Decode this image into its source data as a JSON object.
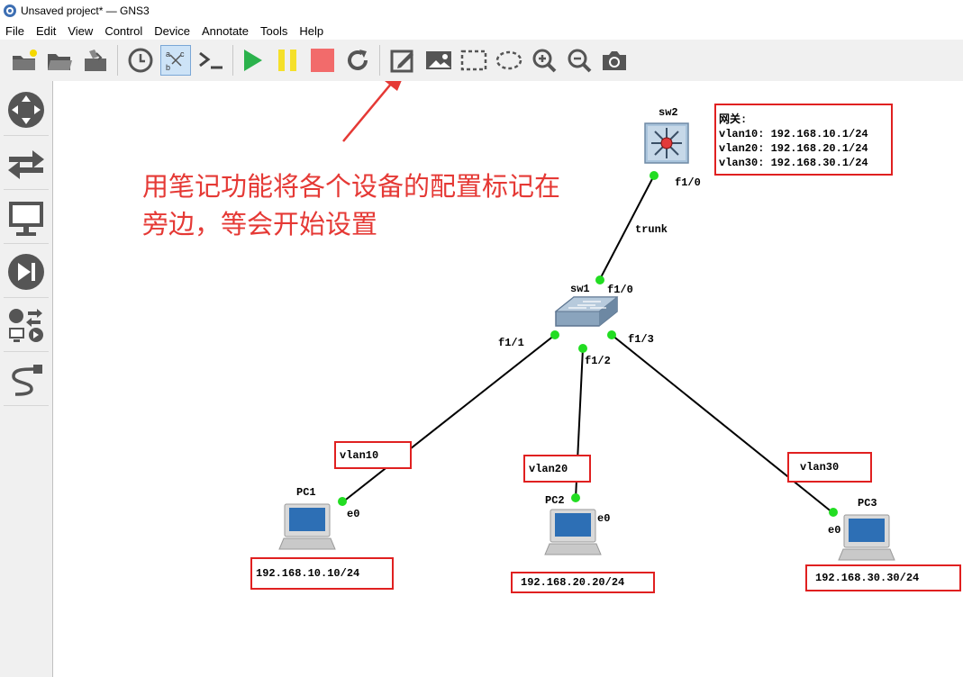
{
  "window": {
    "title": "Unsaved project* — GNS3"
  },
  "menu": [
    "File",
    "Edit",
    "View",
    "Control",
    "Device",
    "Annotate",
    "Tools",
    "Help"
  ],
  "toolbar": {
    "buttons": [
      "open-folder",
      "open-project",
      "snapshot",
      "clock",
      "show-interface-labels",
      "console",
      "start",
      "pause",
      "stop",
      "reload",
      "add-note",
      "insert-image",
      "draw-rectangle",
      "draw-ellipse",
      "zoom-in",
      "zoom-out",
      "screenshot"
    ]
  },
  "colors": {
    "annotation_red": "#e02020",
    "link_green": "#22dd22",
    "note_text": "#e53935"
  },
  "devices": {
    "sw2": "sw2",
    "sw1": "sw1",
    "pc1": "PC1",
    "pc2": "PC2",
    "pc3": "PC3"
  },
  "ports": {
    "sw2_f10": "f1/0",
    "sw1_f10": "f1/0",
    "sw1_f11": "f1/1",
    "sw1_f12": "f1/2",
    "sw1_f13": "f1/3",
    "pc1_e0": "e0",
    "pc2_e0": "e0",
    "pc3_e0": "e0",
    "trunk": "trunk"
  },
  "gateway": {
    "title": "网关:",
    "lines": [
      "vlan10: 192.168.10.1/24",
      "vlan20: 192.168.20.1/24",
      "vlan30: 192.168.30.1/24"
    ]
  },
  "vlans": {
    "pc1": "vlan10",
    "pc2": "vlan20",
    "pc3": "vlan30"
  },
  "ips": {
    "pc1": "192.168.10.10/24",
    "pc2": "192.168.20.20/24",
    "pc3": "192.168.30.30/24"
  },
  "note": {
    "line1": "用笔记功能将各个设备的配置标记在",
    "line2": "旁边，等会开始设置"
  }
}
